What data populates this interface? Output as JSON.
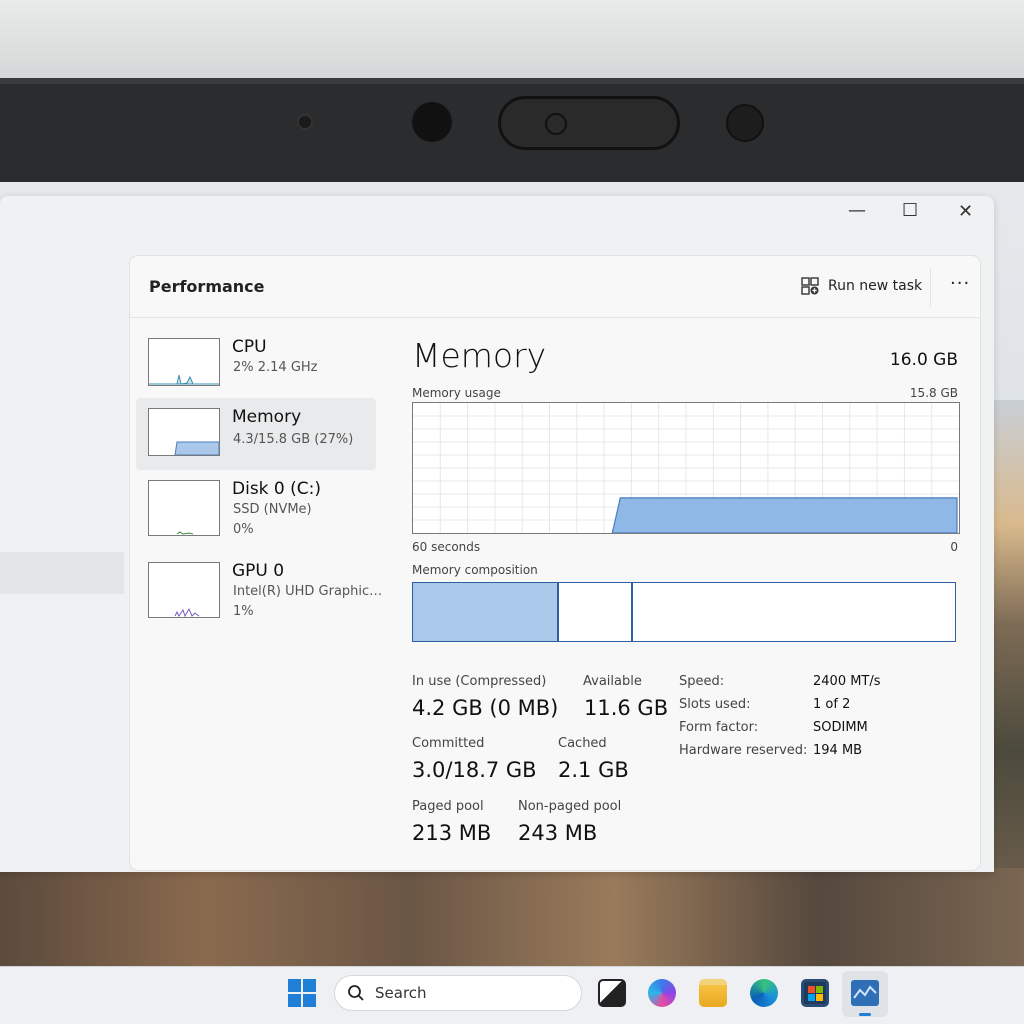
{
  "window": {
    "minimize_glyph": "—",
    "maximize_glyph": "☐",
    "close_glyph": "✕"
  },
  "header": {
    "title": "Performance",
    "run_new_task": "Run new task",
    "more_glyph": "···"
  },
  "sidebar": {
    "items": [
      {
        "name": "CPU",
        "line1": "2% 2.14 GHz",
        "line2": ""
      },
      {
        "name": "Memory",
        "line1": "4.3/15.8 GB (27%)",
        "line2": ""
      },
      {
        "name": "Disk 0 (C:)",
        "line1": "SSD (NVMe)",
        "line2": "0%"
      },
      {
        "name": "GPU 0",
        "line1": "Intel(R) UHD Graphics ...",
        "line2": "1%"
      }
    ]
  },
  "memory": {
    "title": "Memory",
    "total": "16.0 GB",
    "usage_label": "Memory usage",
    "usage_max": "15.8 GB",
    "time_left": "60 seconds",
    "time_right": "0",
    "composition_label": "Memory composition",
    "usage_level": 0.27,
    "stats": {
      "in_use_label": "In use (Compressed)",
      "in_use_value": "4.2 GB (0 MB)",
      "available_label": "Available",
      "available_value": "11.6 GB",
      "committed_label": "Committed",
      "committed_value": "3.0/18.7 GB",
      "cached_label": "Cached",
      "cached_value": "2.1 GB",
      "paged_label": "Paged pool",
      "paged_value": "213 MB",
      "nonpaged_label": "Non-paged pool",
      "nonpaged_value": "243 MB"
    },
    "specs": [
      {
        "label": "Speed:",
        "value": "2400 MT/s"
      },
      {
        "label": "Slots used:",
        "value": "1 of 2"
      },
      {
        "label": "Form factor:",
        "value": "SODIMM"
      },
      {
        "label": "Hardware reserved:",
        "value": "194 MB"
      }
    ]
  },
  "taskbar": {
    "search_label": "Search"
  },
  "colors": {
    "accent": "#8fb8e6",
    "accent_border": "#2f5fa3"
  }
}
